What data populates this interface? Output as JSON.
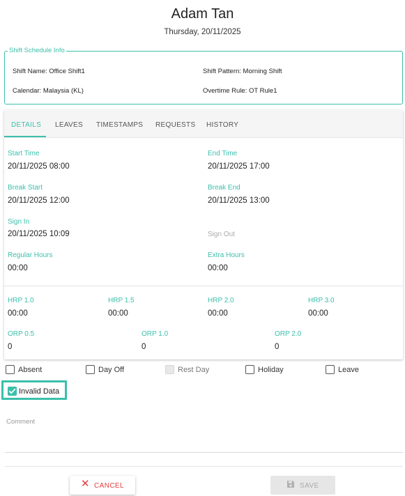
{
  "header": {
    "name": "Adam Tan",
    "date": "Thursday, 20/11/2025"
  },
  "shift_info": {
    "legend": "Shift Schedule Info",
    "shift_name": "Shift Name:  Office Shift1",
    "shift_pattern": "Shift Pattern:  Morning Shift",
    "calendar": "Calendar:  Malaysia (KL)",
    "overtime_rule": "Overtime Rule:  OT Rule1"
  },
  "tabs": [
    {
      "label": "DETAILS",
      "active": true
    },
    {
      "label": "LEAVES",
      "active": false
    },
    {
      "label": "TIMESTAMPS",
      "active": false
    },
    {
      "label": "REQUESTS",
      "active": false
    },
    {
      "label": "HISTORY",
      "active": false
    }
  ],
  "details": {
    "start_time": {
      "label": "Start Time",
      "value": "20/11/2025 08:00"
    },
    "end_time": {
      "label": "End Time",
      "value": "20/11/2025 17:00"
    },
    "break_start": {
      "label": "Break Start",
      "value": "20/11/2025 12:00"
    },
    "break_end": {
      "label": "Break End",
      "value": "20/11/2025 13:00"
    },
    "sign_in": {
      "label": "Sign In",
      "value": "20/11/2025 10:09"
    },
    "sign_out": {
      "label": "Sign Out",
      "value": ""
    },
    "regular_hours": {
      "label": "Regular Hours",
      "value": "00:00"
    },
    "extra_hours": {
      "label": "Extra Hours",
      "value": "00:00"
    },
    "hrp": [
      {
        "label": "HRP 1.0",
        "value": "00:00"
      },
      {
        "label": "HRP 1.5",
        "value": "00:00"
      },
      {
        "label": "HRP 2.0",
        "value": "00:00"
      },
      {
        "label": "HRP 3.0",
        "value": "00:00"
      }
    ],
    "orp": [
      {
        "label": "ORP 0.5",
        "value": "0"
      },
      {
        "label": "ORP 1.0",
        "value": "0"
      },
      {
        "label": "ORP 2.0",
        "value": "0"
      }
    ]
  },
  "checkboxes": [
    {
      "label": "Absent",
      "checked": false,
      "disabled": false
    },
    {
      "label": "Day Off",
      "checked": false,
      "disabled": false
    },
    {
      "label": "Rest Day",
      "checked": false,
      "disabled": true
    },
    {
      "label": "Holiday",
      "checked": false,
      "disabled": false
    },
    {
      "label": "Leave",
      "checked": false,
      "disabled": false
    }
  ],
  "invalid_data": {
    "label": "Invalid Data",
    "checked": true
  },
  "comment": {
    "label": "Comment",
    "value": ""
  },
  "buttons": {
    "cancel": "CANCEL",
    "save": "SAVE"
  },
  "colors": {
    "accent": "#3bbfab",
    "cancel": "#e23c3c",
    "disabled": "#aaaaaa"
  },
  "icons": {
    "cancel": "close-icon",
    "save": "save-icon",
    "check": "check-icon"
  }
}
